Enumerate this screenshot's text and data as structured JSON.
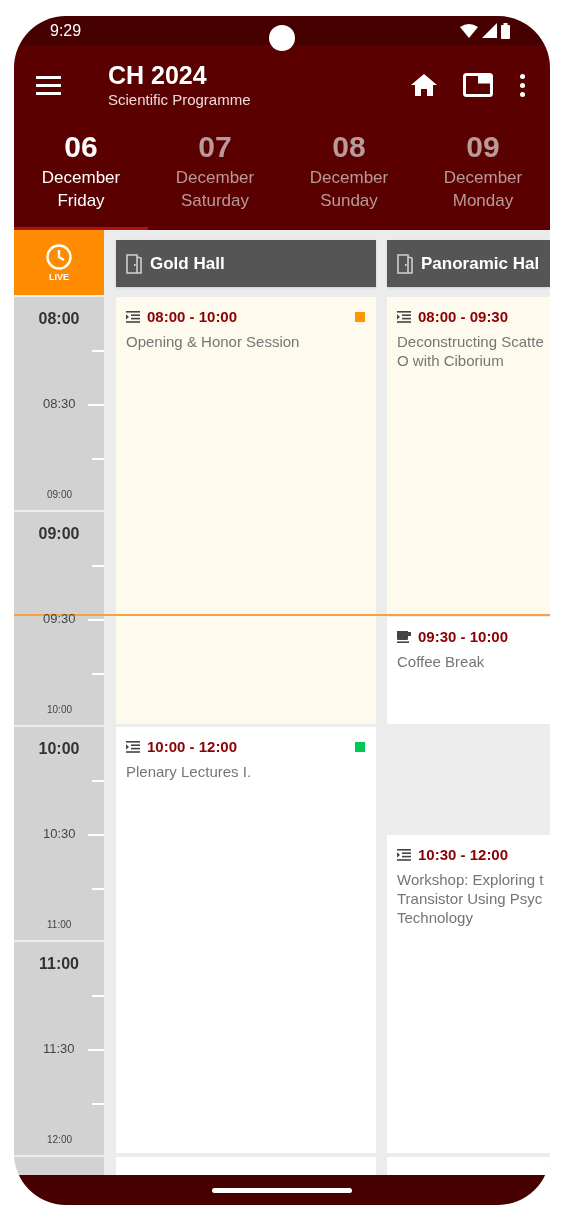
{
  "status_bar": {
    "time": "9:29"
  },
  "app_bar": {
    "title": "CH 2024",
    "subtitle": "Scientific Programme"
  },
  "days": [
    {
      "day": "06",
      "month": "December",
      "weekday": "Friday",
      "selected": true
    },
    {
      "day": "07",
      "month": "December",
      "weekday": "Saturday",
      "selected": false
    },
    {
      "day": "08",
      "month": "December",
      "weekday": "Sunday",
      "selected": false
    },
    {
      "day": "09",
      "month": "December",
      "weekday": "Monday",
      "selected": false
    }
  ],
  "live_button": {
    "label": "LIVE"
  },
  "time_blocks": [
    {
      "hour": "08:00",
      "half": "08:30",
      "end": "09:00"
    },
    {
      "hour": "09:00",
      "half": "09:30",
      "end": "10:00"
    },
    {
      "hour": "10:00",
      "half": "10:30",
      "end": "11:00"
    },
    {
      "hour": "11:00",
      "half": "11:30",
      "end": "12:00"
    }
  ],
  "halls": [
    {
      "name": "Gold Hall",
      "events": [
        {
          "kind": "session",
          "time": "08:00 - 10:00",
          "title_lines": [
            "Opening & Honor Session"
          ],
          "color": "#ff9800",
          "current": true
        },
        {
          "kind": "session",
          "time": "10:00 - 12:00",
          "title_lines": [
            "Plenary Lectures I."
          ],
          "color": "#00c853",
          "current": false
        }
      ]
    },
    {
      "name": "Panoramic Hal",
      "events": [
        {
          "kind": "session",
          "time": "08:00 - 09:30",
          "title_lines": [
            "Deconstructing Scatte",
            "O with Ciborium"
          ],
          "current": true
        },
        {
          "kind": "break",
          "time": "09:30 - 10:00",
          "title_lines": [
            "Coffee Break"
          ],
          "current": false
        },
        {
          "kind": "session",
          "time": "10:30 - 12:00",
          "title_lines": [
            "Workshop: Exploring t",
            "Transistor Using Psyc",
            "Technology"
          ],
          "current": false
        }
      ]
    }
  ]
}
